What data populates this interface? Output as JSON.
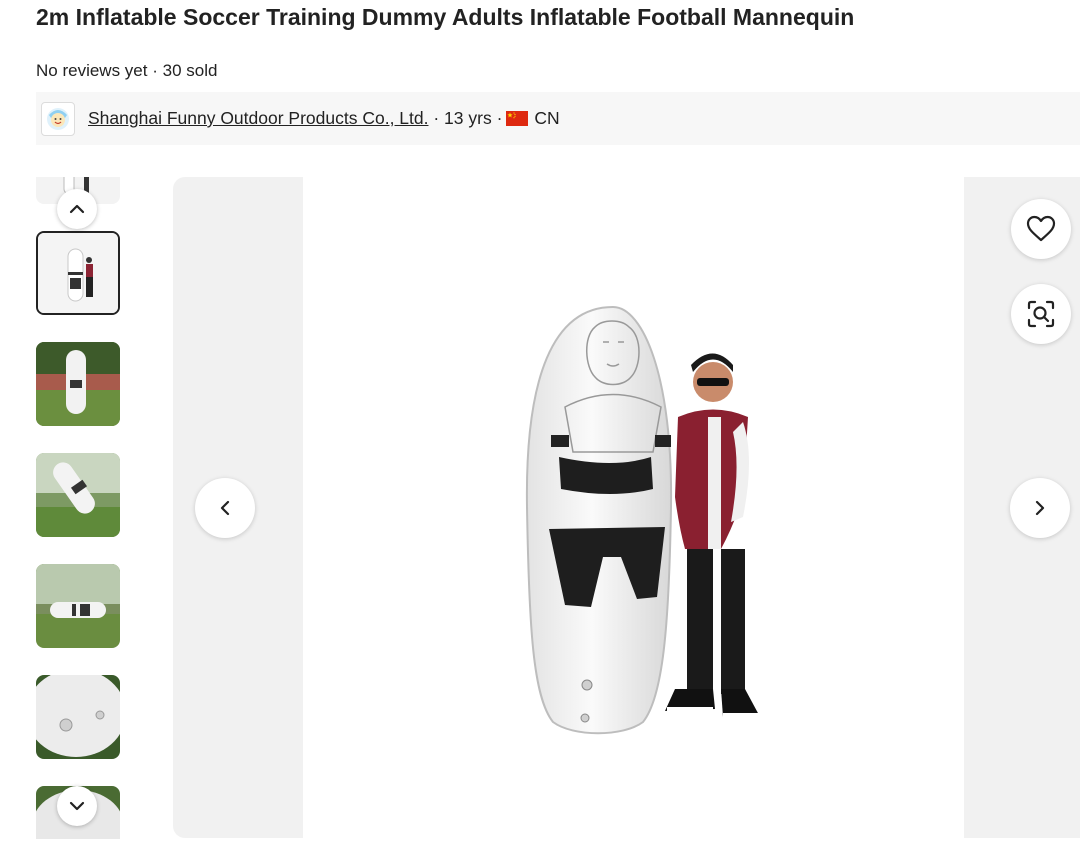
{
  "product": {
    "title": "2m Inflatable Soccer Training Dummy Adults Inflatable Football Mannequin",
    "reviews": "No reviews yet",
    "separator": "·",
    "sold": "30 sold"
  },
  "supplier": {
    "logo_icon": "supplier-logo",
    "name": "Shanghai Funny Outdoor Products Co., Ltd.",
    "years": "13 yrs",
    "country_code": "CN",
    "flag_color": "#de2910"
  },
  "gallery": {
    "thumbnail_count": 7,
    "selected_index": 1,
    "icons": {
      "scroll_up": "chevron-up-icon",
      "scroll_down": "chevron-down-icon",
      "previous": "chevron-left-icon",
      "next": "chevron-right-icon",
      "favorite": "heart-icon",
      "image_search": "image-search-icon"
    },
    "colors": {
      "panel_bg": "#f1f1f1",
      "selected_border": "#222222"
    }
  }
}
